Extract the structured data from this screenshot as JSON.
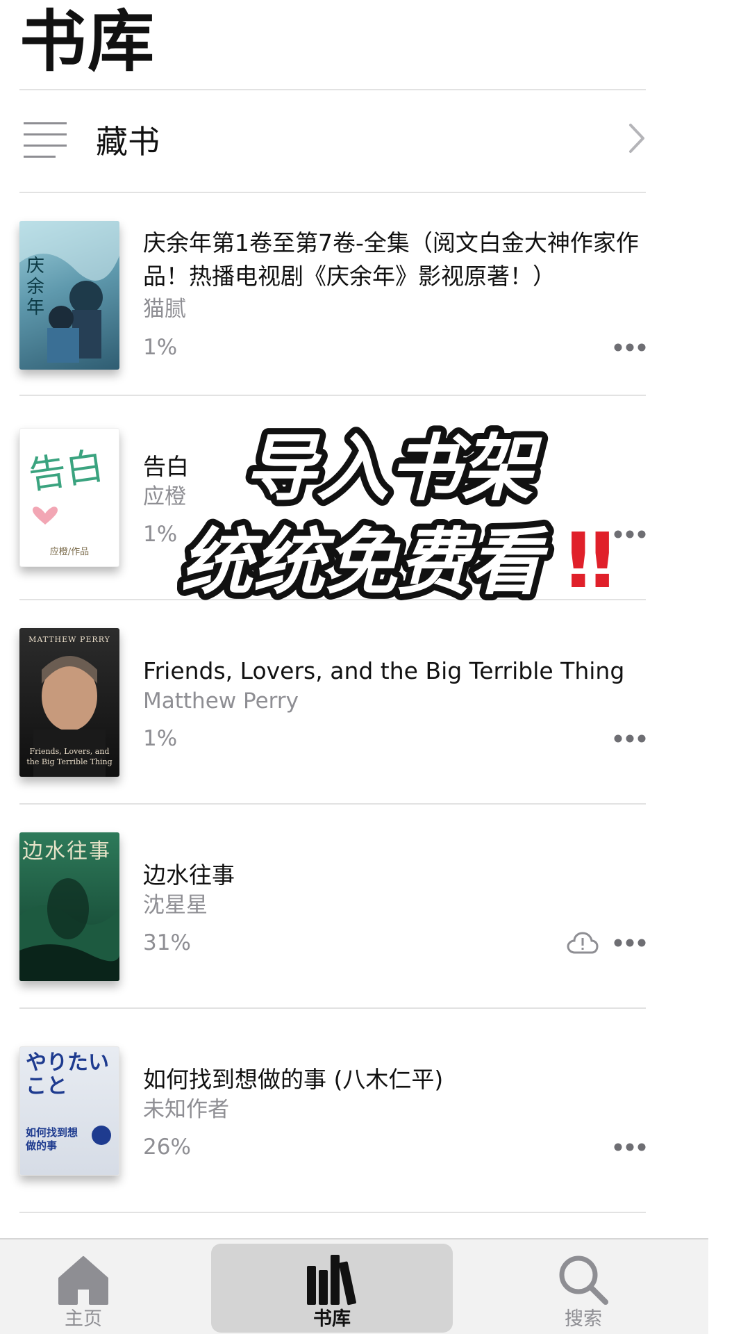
{
  "header": {
    "title": "书库"
  },
  "collection": {
    "label": "藏书"
  },
  "books": [
    {
      "title": "庆余年第1卷至第7卷-全集（阅文白金大神作家作品！热播电视剧《庆余年》影视原著！）",
      "author": "猫腻",
      "progress": "1%",
      "cover_text": "庆余年",
      "cover_colors": [
        "#7fb9c9",
        "#2f5d72"
      ]
    },
    {
      "title": "告白",
      "author": "应橙",
      "progress": "1%",
      "cover_text": "告白",
      "cover_subtext": "应橙/作品",
      "cover_colors": [
        "#ffffff",
        "#f4f4f4"
      ]
    },
    {
      "title": "Friends, Lovers, and the Big Terrible Thing",
      "author": "Matthew Perry",
      "progress": "1%",
      "cover_text": "MATTHEW PERRY",
      "cover_subtext": "Friends, Lovers, and the Big Terrible Thing",
      "cover_colors": [
        "#2c2c2c",
        "#0f0f0f"
      ]
    },
    {
      "title": "边水往事",
      "author": "沈星星",
      "progress": "31%",
      "cover_text": "边水往事",
      "cover_colors": [
        "#2e7a5a",
        "#0f3b2a"
      ],
      "cloud": true
    },
    {
      "title": "如何找到想做的事 (八木仁平)",
      "author": "未知作者",
      "progress": "26%",
      "cover_text": "やりたいこと",
      "cover_subtext": "如何找到想做的事",
      "cover_colors": [
        "#e8ecf2",
        "#d6dce6"
      ]
    }
  ],
  "overlay": {
    "line1": "导入书架",
    "line2": "统统免费看",
    "marks": "‼",
    "color": "#ffffff",
    "mark_color": "#e0202a"
  },
  "tabs": [
    {
      "label": "主页",
      "icon": "home-icon",
      "active": false
    },
    {
      "label": "书库",
      "icon": "library-icon",
      "active": true
    },
    {
      "label": "搜索",
      "icon": "search-icon",
      "active": false
    }
  ]
}
